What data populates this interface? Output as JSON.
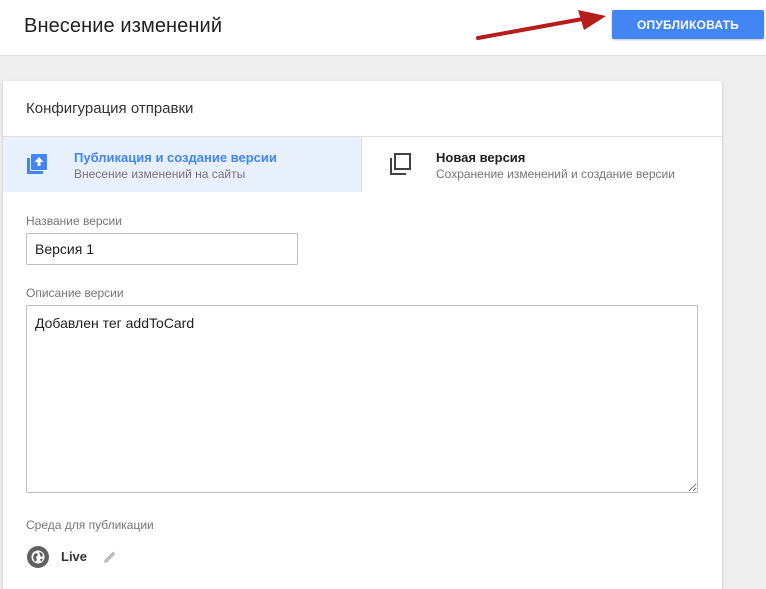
{
  "header": {
    "title": "Внесение изменений",
    "publish_label": "ОПУБЛИКОВАТЬ"
  },
  "card": {
    "title": "Конфигурация отправки",
    "options": [
      {
        "title": "Публикация и создание версии",
        "subtitle": "Внесение изменений на сайты",
        "icon": "publish-upload-icon",
        "selected": true
      },
      {
        "title": "Новая версия",
        "subtitle": "Сохранение изменений и создание версии",
        "icon": "copy-version-icon",
        "selected": false
      }
    ],
    "version_name": {
      "label": "Название версии",
      "value": "Версия 1"
    },
    "version_description": {
      "label": "Описание версии",
      "value": "Добавлен тег addToCard"
    },
    "environment": {
      "label": "Среда для публикации",
      "name": "Live",
      "icon": "globe-icon",
      "edit_icon": "pencil-icon"
    }
  },
  "colors": {
    "accent": "#4285f4",
    "selected_bg": "#e8f0fe",
    "arrow": "#b71c1c"
  }
}
